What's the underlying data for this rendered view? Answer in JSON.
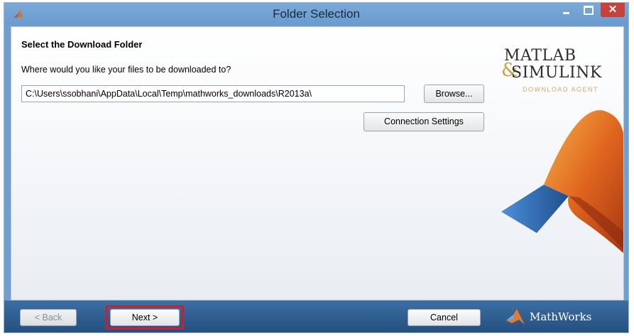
{
  "window": {
    "title": "Folder Selection",
    "controls": {
      "minimize": "minimize-icon",
      "maximize": "maximize-icon",
      "close": "close-icon"
    },
    "close_glyph": "✕"
  },
  "main": {
    "heading": "Select the Download Folder",
    "question": "Where would you like your files to be downloaded to?",
    "download_path": "C:\\Users\\ssobhani\\AppData\\Local\\Temp\\mathworks_downloads\\R2013a\\",
    "browse_label": "Browse...",
    "connection_settings_label": "Connection Settings"
  },
  "branding": {
    "matlab": "MATLAB",
    "amp": "&",
    "simulink": "SIMULINK",
    "subtitle": "DOWNLOAD AGENT",
    "vendor": "MathWorks"
  },
  "footer": {
    "back_label": "< Back",
    "next_label": "Next >",
    "cancel_label": "Cancel"
  },
  "colors": {
    "title_bar": "#6a9bce",
    "footer": "#2f5d91",
    "highlight": "#c8202e",
    "close_button": "#c8413a"
  }
}
